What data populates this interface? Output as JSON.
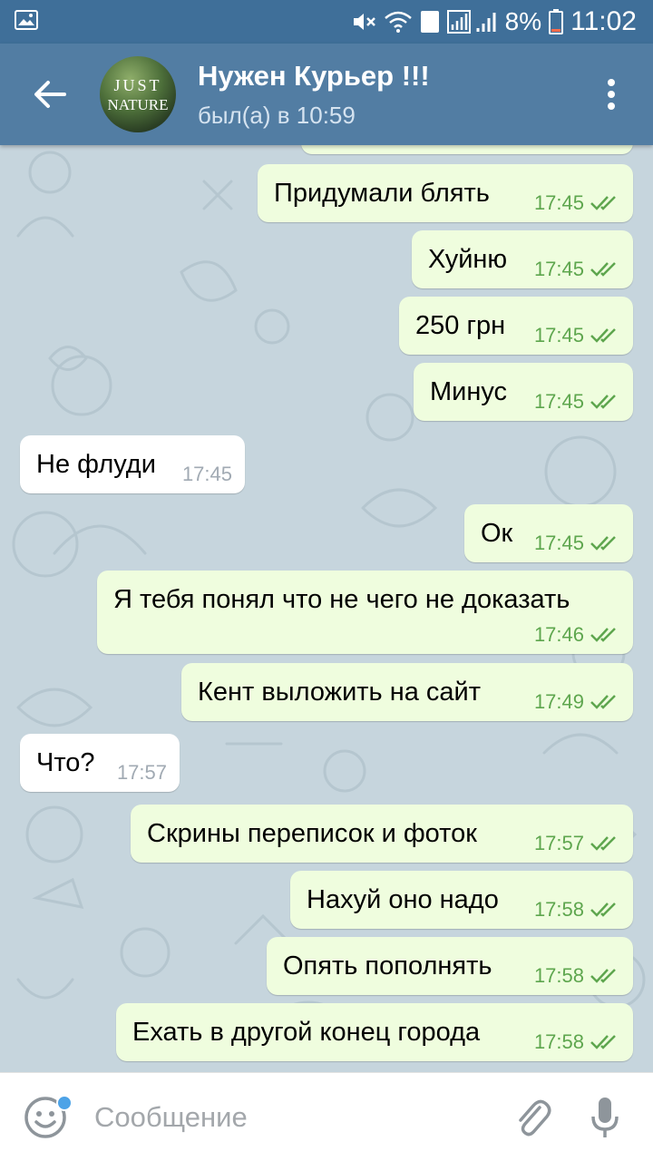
{
  "status_bar": {
    "time": "11:02",
    "battery": "8%",
    "sim_badge": "1",
    "icons": [
      "gallery-icon",
      "mute-icon",
      "wifi-icon",
      "signal-icon",
      "battery-icon"
    ]
  },
  "header": {
    "title": "Нужен Курьер !!!",
    "status": "был(а) в 10:59",
    "avatar_line1": "JUST",
    "avatar_line2": "NATURE"
  },
  "messages": [
    {
      "text": "Придумали блять",
      "time": "17:45",
      "direction": "out"
    },
    {
      "text": "Хуйню",
      "time": "17:45",
      "direction": "out"
    },
    {
      "text": "250 грн",
      "time": "17:45",
      "direction": "out"
    },
    {
      "text": "Минус",
      "time": "17:45",
      "direction": "out"
    },
    {
      "text": "Не флуди",
      "time": "17:45",
      "direction": "in"
    },
    {
      "text": "Ок",
      "time": "17:45",
      "direction": "out"
    },
    {
      "text": "Я тебя понял что не чего не доказать",
      "time": "17:46",
      "direction": "out"
    },
    {
      "text": "Кент выложить на сайт",
      "time": "17:49",
      "direction": "out"
    },
    {
      "text": "Что?",
      "time": "17:57",
      "direction": "in"
    },
    {
      "text": "Скрины переписок и фоток",
      "time": "17:57",
      "direction": "out"
    },
    {
      "text": "Нахуй оно надо",
      "time": "17:58",
      "direction": "out"
    },
    {
      "text": "Опять пополнять",
      "time": "17:58",
      "direction": "out"
    },
    {
      "text": "Ехать в другой конец города",
      "time": "17:58",
      "direction": "out"
    }
  ],
  "input": {
    "placeholder": "Сообщение"
  },
  "colors": {
    "header": "#527da3",
    "status_bar": "#3f6f99",
    "outgoing_bubble": "#effdde",
    "incoming_bubble": "#ffffff",
    "check_green": "#5ea64e",
    "accent_blue": "#4da3e7"
  }
}
